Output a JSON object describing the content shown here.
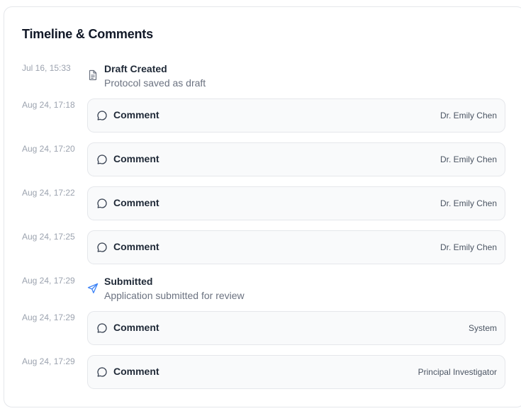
{
  "panel": {
    "title": "Timeline & Comments"
  },
  "timeline": [
    {
      "time": "Jul 16, 15:33",
      "kind": "event",
      "icon": "document-icon",
      "title": "Draft Created",
      "description": "Protocol saved as draft"
    },
    {
      "time": "Aug 24, 17:18",
      "kind": "comment",
      "icon": "chat-bubble-icon",
      "label": "Comment",
      "author": "Dr. Emily Chen"
    },
    {
      "time": "Aug 24, 17:20",
      "kind": "comment",
      "icon": "chat-bubble-icon",
      "label": "Comment",
      "author": "Dr. Emily Chen"
    },
    {
      "time": "Aug 24, 17:22",
      "kind": "comment",
      "icon": "chat-bubble-icon",
      "label": "Comment",
      "author": "Dr. Emily Chen"
    },
    {
      "time": "Aug 24, 17:25",
      "kind": "comment",
      "icon": "chat-bubble-icon",
      "label": "Comment",
      "author": "Dr. Emily Chen"
    },
    {
      "time": "Aug 24, 17:29",
      "kind": "event",
      "icon": "send-icon",
      "title": "Submitted",
      "description": "Application submitted for review"
    },
    {
      "time": "Aug 24, 17:29",
      "kind": "comment",
      "icon": "chat-bubble-icon",
      "label": "Comment",
      "author": "System"
    },
    {
      "time": "Aug 24, 17:29",
      "kind": "comment",
      "icon": "chat-bubble-icon",
      "label": "Comment",
      "author": "Principal Investigator"
    }
  ],
  "colors": {
    "send_icon": "#3b82f6",
    "muted_icon": "#6b7280"
  }
}
